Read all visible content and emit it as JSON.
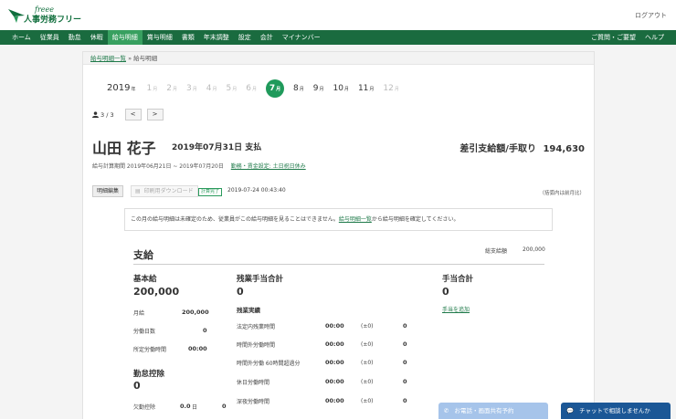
{
  "app": {
    "logo_script": "freee",
    "logo_text": "人事労務フリー",
    "logout": "ログアウト"
  },
  "nav": {
    "items": [
      "ホーム",
      "従業員",
      "勤怠",
      "休暇",
      "給与明細",
      "賞与明細",
      "書類",
      "年末調整",
      "設定",
      "会計",
      "マイナンバー"
    ],
    "active_index": 4,
    "right": [
      "ご質問・ご要望",
      "ヘルプ"
    ]
  },
  "breadcrumb": {
    "link": "給与明細一覧",
    "sep": "»",
    "current": "給与明細"
  },
  "months": {
    "year": "2019",
    "year_suffix": "年",
    "suffix": "月",
    "items": [
      "1",
      "2",
      "3",
      "4",
      "5",
      "6",
      "7",
      "8",
      "9",
      "10",
      "11",
      "12"
    ],
    "active": "7"
  },
  "pager": {
    "count": "3 / 3",
    "prev": "<",
    "next": ">"
  },
  "employee": {
    "name": "山田 花子",
    "payday": "2019年07月31日 支払"
  },
  "net_pay": {
    "label": "差引支給額/手取り",
    "value": "194,630"
  },
  "period": {
    "text": "給与計算期間 2019年06月21日 ~ 2019年07月20日",
    "link": "勤務・賃金設定: 土日祝日休み"
  },
  "toolbar": {
    "edit": "明細編集",
    "download": "印刷用ダウンロード",
    "badge": "計算完了",
    "calc_date": "2019-07-24 00:43:40",
    "note": "（括弧内は前月比）"
  },
  "notice": {
    "before": "この月の給与明細は未確定のため、従業員がこの給与明細を見ることはできません。",
    "link": "給与明細一覧",
    "after": "から給与明細を確定してください。"
  },
  "pay": {
    "heading": "支給",
    "total_label": "総支給額",
    "total_value": "200,000",
    "base": {
      "title": "基本給",
      "value": "200,000",
      "rows": [
        {
          "label": "月給",
          "value": "200,000"
        },
        {
          "label": "労働日数",
          "value": "0"
        },
        {
          "label": "所定労働時間",
          "value": "00:00"
        }
      ]
    },
    "deduction": {
      "title": "勤怠控除",
      "value": "0",
      "row": {
        "label": "欠勤控除",
        "value": "0.0",
        "unit": "日",
        "amount": "0"
      }
    },
    "overtime": {
      "title": "残業手当合計",
      "value": "0",
      "sub": "残業実績",
      "rows": [
        {
          "label": "法定内残業時間",
          "time": "00:00",
          "diff": "(±0)",
          "amount": "0"
        },
        {
          "label": "時間外労働時間",
          "time": "00:00",
          "diff": "(±0)",
          "amount": "0"
        },
        {
          "label": "時間外労働 60時間超過分",
          "time": "00:00",
          "diff": "(±0)",
          "amount": "0"
        },
        {
          "label": "休日労働時間",
          "time": "00:00",
          "diff": "(±0)",
          "amount": "0"
        },
        {
          "label": "深夜労働時間",
          "time": "00:00",
          "diff": "(±0)",
          "amount": "0"
        }
      ]
    },
    "allowance": {
      "title": "手当合計",
      "value": "0",
      "link": "手当を追加"
    }
  },
  "support": {
    "phone": "お電話・画面共有予約",
    "chat": "チャットで相談しませんか"
  }
}
